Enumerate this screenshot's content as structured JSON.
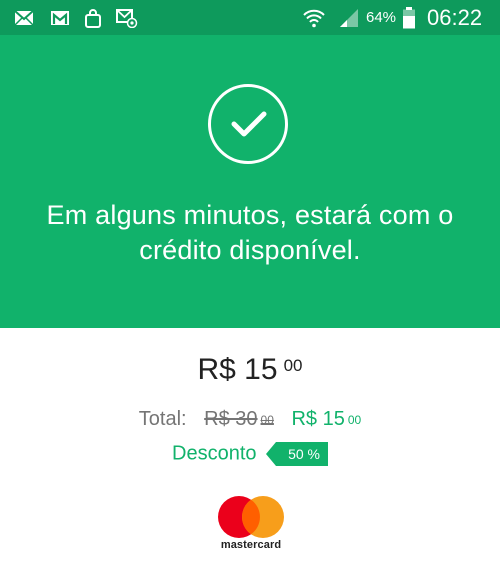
{
  "status_bar": {
    "battery": "64%",
    "time": "06:22",
    "icons": [
      "mail-icon",
      "gmail-icon",
      "shopping-bag-icon",
      "email-notification-icon",
      "wifi-icon",
      "signal-icon",
      "battery-icon"
    ]
  },
  "success": {
    "icon": "check-icon",
    "message": "Em alguns minutos, estará com o crédito disponível."
  },
  "amount": {
    "main": "R$ 15",
    "cents": "00"
  },
  "total": {
    "label": "Total:",
    "old_price": "R$ 30",
    "old_cents": "00",
    "new_price": "R$ 15",
    "new_cents": "00"
  },
  "discount": {
    "label": "Desconto",
    "value": "50 %"
  },
  "payment": {
    "brand": "mastercard",
    "icon": "mastercard-logo"
  },
  "colors": {
    "status_bar": "#0e9a5c",
    "accent_green": "#11b26b",
    "text_dark": "#222222",
    "text_muted": "#757575",
    "mastercard_red": "#eb001b",
    "mastercard_orange": "#f79e1b"
  }
}
